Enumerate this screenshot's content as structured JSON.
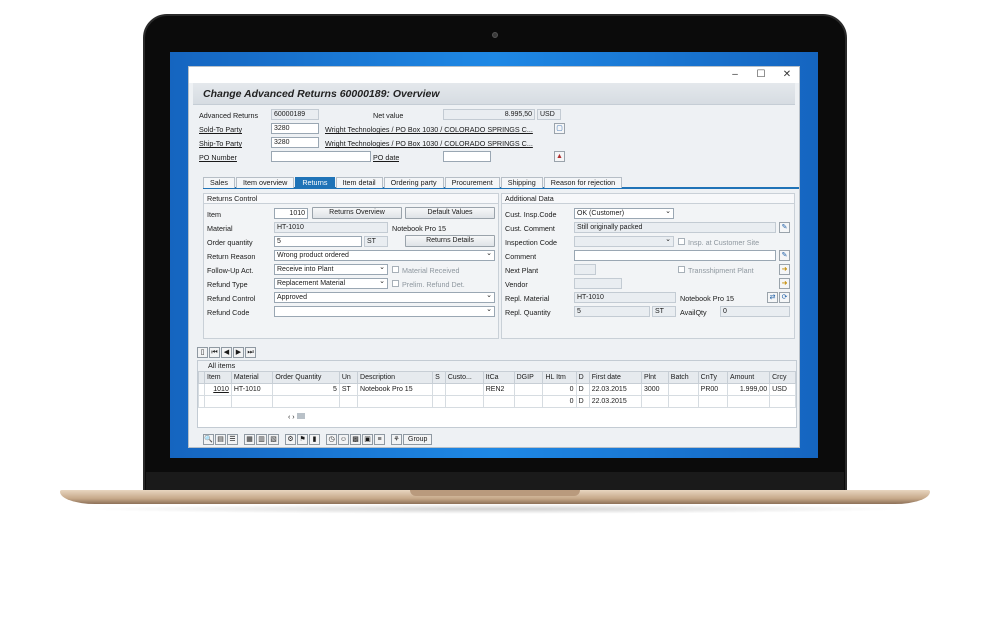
{
  "window": {
    "title": "Change Advanced Returns 60000189: Overview",
    "controls": {
      "minimize": "–",
      "maximize": "☐",
      "close": "✕"
    }
  },
  "header_fields": {
    "advanced_returns": {
      "label": "Advanced Returns",
      "value": "60000189"
    },
    "net_value": {
      "label": "Net value",
      "value": "8.995,50",
      "currency": "USD"
    },
    "sold_to": {
      "label": "Sold-To Party",
      "value": "3280",
      "desc": "Wright Technologies / PO Box 1030 / COLORADO SPRINGS C..."
    },
    "ship_to": {
      "label": "Ship-To Party",
      "value": "3280",
      "desc": "Wright Technologies / PO Box 1030 / COLORADO SPRINGS C..."
    },
    "po_number": {
      "label": "PO Number",
      "value": ""
    },
    "po_date": {
      "label": "PO date",
      "value": ""
    }
  },
  "tabs": [
    {
      "label": "Sales",
      "active": false
    },
    {
      "label": "Item overview",
      "active": false
    },
    {
      "label": "Returns",
      "active": true
    },
    {
      "label": "Item detail",
      "active": false
    },
    {
      "label": "Ordering party",
      "active": false
    },
    {
      "label": "Procurement",
      "active": false
    },
    {
      "label": "Shipping",
      "active": false
    },
    {
      "label": "Reason for rejection",
      "active": false
    }
  ],
  "returns_control": {
    "title": "Returns Control",
    "item": {
      "label": "Item",
      "value": "1010"
    },
    "returns_overview_btn": "Returns Overview",
    "default_values_btn": "Default Values",
    "material": {
      "label": "Material",
      "value": "HT-1010",
      "desc": "Notebook Pro 15"
    },
    "order_quantity": {
      "label": "Order quantity",
      "value": "5",
      "unit": "ST"
    },
    "returns_details_btn": "Returns Details",
    "return_reason": {
      "label": "Return Reason",
      "value": "Wrong product ordered"
    },
    "follow_up": {
      "label": "Follow-Up Act.",
      "value": "Receive into Plant",
      "check_label": "Material Received"
    },
    "refund_type": {
      "label": "Refund Type",
      "value": "Replacement Material",
      "check_label": "Prelim. Refund Det."
    },
    "refund_control": {
      "label": "Refund Control",
      "value": "Approved"
    },
    "refund_code": {
      "label": "Refund Code",
      "value": ""
    }
  },
  "additional_data": {
    "title": "Additional Data",
    "cust_insp_code": {
      "label": "Cust. Insp.Code",
      "value": "OK (Customer)"
    },
    "cust_comment": {
      "label": "Cust. Comment",
      "value": "Still originally packed"
    },
    "inspection_code": {
      "label": "Inspection Code",
      "value": "",
      "check_label": "Insp. at Customer Site"
    },
    "comment": {
      "label": "Comment",
      "value": ""
    },
    "next_plant": {
      "label": "Next Plant",
      "value": "",
      "check_label": "Transshipment Plant"
    },
    "vendor": {
      "label": "Vendor",
      "value": ""
    },
    "repl_material": {
      "label": "Repl. Material",
      "value": "HT-1010",
      "desc": "Notebook Pro 15"
    },
    "repl_quantity": {
      "label": "Repl. Quantity",
      "value": "5",
      "unit": "ST",
      "avail_label": "AvailQty",
      "avail_value": "0"
    }
  },
  "items": {
    "title": "All items",
    "columns": [
      "Item",
      "Material",
      "Order Quantity",
      "Un",
      "Description",
      "S",
      "Custo...",
      "ItCa",
      "DGIP",
      "HL Itm",
      "D",
      "First date",
      "Plnt",
      "Batch",
      "CnTy",
      "Amount",
      "Crcy"
    ],
    "rows": [
      [
        "1010",
        "HT-1010",
        "5",
        "ST",
        "Notebook Pro 15",
        "",
        "",
        "REN2",
        "",
        "0",
        "D",
        "22.03.2015",
        "3000",
        "",
        "PR00",
        "1.999,00",
        "USD"
      ],
      [
        "",
        "",
        "",
        "",
        "",
        "",
        "",
        "",
        "",
        "0",
        "D",
        "22.03.2015",
        "",
        "",
        "",
        "",
        ""
      ]
    ]
  },
  "bottom_toolbar": {
    "group_label": "Group"
  }
}
